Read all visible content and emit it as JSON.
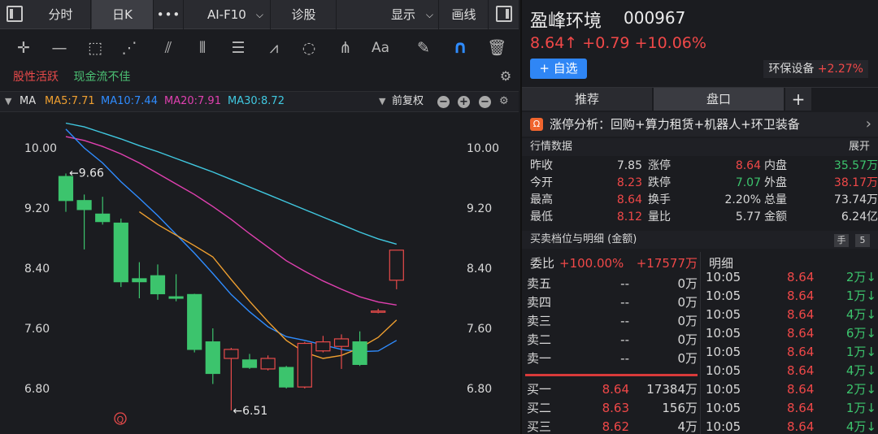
{
  "topbar": {
    "tabs": [
      "分时",
      "日K"
    ],
    "more": "•••",
    "ai_f10": "AI-F10",
    "diagnose": "诊股",
    "display": "显示",
    "draw_line": "画线"
  },
  "tools": [
    "crosshair-icon",
    "line-icon",
    "rect-icon",
    "fan-icon",
    "channel-icon",
    "bars-icon",
    "fib-icon",
    "wave-icon",
    "cycle-icon",
    "gann-icon",
    "text-icon",
    "eraser-icon",
    "magnet-icon",
    "trash-icon"
  ],
  "tags": {
    "hot": "股性活跃",
    "cash": "现金流不佳"
  },
  "ma": {
    "label": "MA",
    "ma5": "MA5:7.71",
    "ma10": "MA10:7.44",
    "ma20": "MA20:7.91",
    "ma30": "MA30:8.72",
    "adjust": "前复权",
    "colors": {
      "ma5": "#f0a030",
      "ma10": "#2f8cff",
      "ma20": "#e040b0",
      "ma30": "#40c8e0"
    }
  },
  "chart_data": {
    "type": "candlestick",
    "y_ticks": [
      "10.00",
      "9.20",
      "8.40",
      "7.60",
      "6.80"
    ],
    "y_tick_values": [
      10.0,
      9.2,
      8.4,
      7.6,
      6.8
    ],
    "annotations": {
      "high": "←9.66",
      "low": "←6.51",
      "marker": "Q"
    },
    "annotation_values": {
      "high": 9.66,
      "low": 6.51
    },
    "candles": [
      {
        "o": 9.62,
        "c": 9.3,
        "h": 9.66,
        "l": 9.15
      },
      {
        "o": 9.3,
        "c": 9.18,
        "h": 9.38,
        "l": 8.65
      },
      {
        "o": 9.12,
        "c": 9.02,
        "h": 9.35,
        "l": 8.98
      },
      {
        "o": 9.0,
        "c": 8.22,
        "h": 9.06,
        "l": 8.15
      },
      {
        "o": 8.26,
        "c": 8.22,
        "h": 8.48,
        "l": 8.0
      },
      {
        "o": 8.3,
        "c": 8.06,
        "h": 8.45,
        "l": 7.98
      },
      {
        "o": 8.02,
        "c": 8.0,
        "h": 8.32,
        "l": 7.96
      },
      {
        "o": 8.05,
        "c": 7.32,
        "h": 8.06,
        "l": 7.28
      },
      {
        "o": 7.42,
        "c": 7.0,
        "h": 7.6,
        "l": 6.86
      },
      {
        "o": 7.2,
        "c": 7.32,
        "h": 7.34,
        "l": 6.51
      },
      {
        "o": 7.18,
        "c": 7.08,
        "h": 7.26,
        "l": 7.06
      },
      {
        "o": 7.06,
        "c": 7.2,
        "h": 7.24,
        "l": 7.04
      },
      {
        "o": 7.08,
        "c": 6.82,
        "h": 7.1,
        "l": 6.8
      },
      {
        "o": 6.82,
        "c": 7.4,
        "h": 7.42,
        "l": 6.8
      },
      {
        "o": 7.3,
        "c": 7.42,
        "h": 7.5,
        "l": 7.28
      },
      {
        "o": 7.36,
        "c": 7.46,
        "h": 7.52,
        "l": 7.06
      },
      {
        "o": 7.42,
        "c": 7.12,
        "h": 7.56,
        "l": 7.1
      },
      {
        "o": 7.82,
        "c": 7.83,
        "h": 7.86,
        "l": 7.8
      },
      {
        "o": 8.24,
        "c": 8.64,
        "h": 8.64,
        "l": 8.12
      }
    ],
    "ma5": [
      null,
      null,
      null,
      null,
      9.15,
      8.98,
      8.84,
      8.7,
      8.55,
      8.25,
      7.96,
      7.69,
      7.44,
      7.28,
      7.2,
      7.24,
      7.34,
      7.48,
      7.71
    ],
    "ma10": [
      10.25,
      10.0,
      9.8,
      9.55,
      9.33,
      9.1,
      8.85,
      8.6,
      8.33,
      8.05,
      7.82,
      7.62,
      7.49,
      7.44,
      7.38,
      7.32,
      7.29,
      7.3,
      7.44
    ],
    "ma20": [
      10.15,
      10.1,
      10.02,
      9.92,
      9.8,
      9.66,
      9.52,
      9.38,
      9.22,
      9.05,
      8.86,
      8.68,
      8.5,
      8.36,
      8.23,
      8.12,
      8.02,
      7.95,
      7.91
    ],
    "ma30": [
      10.33,
      10.28,
      10.2,
      10.12,
      10.03,
      9.95,
      9.86,
      9.77,
      9.68,
      9.58,
      9.48,
      9.38,
      9.28,
      9.18,
      9.08,
      8.98,
      8.88,
      8.79,
      8.72
    ]
  },
  "stock": {
    "name": "盈峰环境",
    "code": "000967",
    "price": "8.64↑",
    "change": "+0.79",
    "change_pct": "+10.06%",
    "fav": "+ 自选",
    "sector": "环保设备",
    "sector_pct": "+2.27%"
  },
  "tabs": [
    "推荐",
    "盘口",
    "+"
  ],
  "analysis": {
    "icon": "Ω",
    "text": "涨停分析：回购+算力租赁+机器人+环卫装备",
    "arrow": "›"
  },
  "quote": {
    "title": "行情数据",
    "expand": "展开",
    "rows": [
      [
        [
          "昨收",
          "7.85",
          "w"
        ],
        [
          "涨停",
          "8.64",
          "r"
        ],
        [
          "内盘",
          "35.57万",
          "g"
        ]
      ],
      [
        [
          "今开",
          "8.23",
          "r"
        ],
        [
          "跌停",
          "7.07",
          "g"
        ],
        [
          "外盘",
          "38.17万",
          "r"
        ]
      ],
      [
        [
          "最高",
          "8.64",
          "r"
        ],
        [
          "换手",
          "2.20%",
          "w"
        ],
        [
          "总量",
          "73.74万",
          "w"
        ]
      ],
      [
        [
          "最低",
          "8.12",
          "r"
        ],
        [
          "量比",
          "5.77",
          "w"
        ],
        [
          "金额",
          "6.24亿",
          "w"
        ]
      ]
    ]
  },
  "orderbook": {
    "title": "买卖档位与明细 (金额)",
    "hand": "手",
    "five": "5",
    "wb_label": "委比",
    "wb_pct": "+100.00%",
    "wb_amt": "+17577万",
    "sells": [
      [
        "卖五",
        "--",
        "0万"
      ],
      [
        "卖四",
        "--",
        "0万"
      ],
      [
        "卖三",
        "--",
        "0万"
      ],
      [
        "卖二",
        "--",
        "0万"
      ],
      [
        "卖一",
        "--",
        "0万"
      ]
    ],
    "buys": [
      [
        "买一",
        "8.64",
        "17384万"
      ],
      [
        "买二",
        "8.63",
        "156万"
      ],
      [
        "买三",
        "8.62",
        "4万"
      ]
    ]
  },
  "detail": {
    "title": "明细",
    "rows": [
      [
        "10:05",
        "8.64",
        "2万↓"
      ],
      [
        "10:05",
        "8.64",
        "1万↓"
      ],
      [
        "10:05",
        "8.64",
        "4万↓"
      ],
      [
        "10:05",
        "8.64",
        "6万↓"
      ],
      [
        "10:05",
        "8.64",
        "1万↓"
      ],
      [
        "10:05",
        "8.64",
        "4万↓"
      ],
      [
        "10:05",
        "8.64",
        "2万↓"
      ],
      [
        "10:05",
        "8.64",
        "1万↓"
      ],
      [
        "10:05",
        "8.64",
        "4万↓"
      ]
    ]
  }
}
